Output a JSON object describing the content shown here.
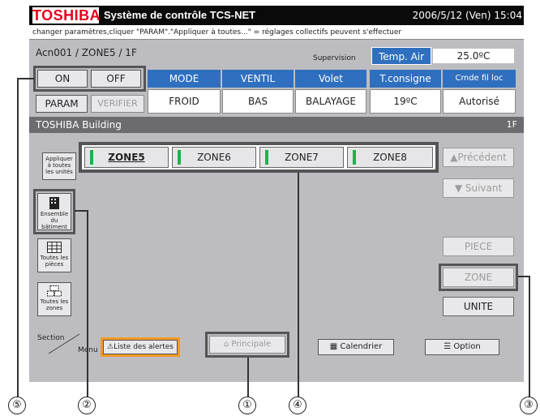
{
  "topbar": {
    "logo": "TOSHIBA",
    "title": "Système de contrôle TCS-NET",
    "datetime": "2006/5/12 (Ven)  15:04"
  },
  "hint": "changer paramètres,cliquer \"PARAM\".\"Appliquer à toutes...\" = réglages collectifs peuvent s'effectuer",
  "unit": {
    "id": "Acn001 / ZONE5 / 1F",
    "supervision": "Supervision"
  },
  "temp_air": {
    "label": "Temp. Air",
    "value": "25.0ºC"
  },
  "controls": {
    "on": "ON",
    "off": "OFF",
    "param": "PARAM",
    "verifier": "VERIFIER"
  },
  "status": [
    {
      "label": "MODE",
      "value": "FROID"
    },
    {
      "label": "VENTIL",
      "value": "BAS"
    },
    {
      "label": "Volet",
      "value": "BALAYAGE"
    },
    {
      "label": "T.consigne",
      "value": "19ºC"
    },
    {
      "label": "Cmde fil loc",
      "value": "Autorisé"
    }
  ],
  "building": {
    "name": "TOSHIBA Building",
    "floor": "1F"
  },
  "apply_all": {
    "line1": "Appliquer",
    "line2": "à toutes",
    "line3": "les unités"
  },
  "zones": [
    "ZONE5",
    "ZONE6",
    "ZONE7",
    "ZONE8"
  ],
  "nav": {
    "prev": "▲Précédent",
    "next": "▼ Suivant"
  },
  "side": [
    {
      "line1": "Ensemble",
      "line2": "du",
      "line3": "bâtiment",
      "icon": "building-icon"
    },
    {
      "line1": "Toutes les",
      "line2": "pièces",
      "line3": "",
      "icon": "rooms-grid-icon"
    },
    {
      "line1": "Toutes les",
      "line2": "zones",
      "line3": "",
      "icon": "zones-icon"
    }
  ],
  "right_buttons": {
    "piece": "PIECE",
    "zone": "ZONE",
    "unite": "UNITE"
  },
  "bottom": {
    "section": "Section",
    "menu": "Menu",
    "alerts": "Liste des alertes",
    "principale": "Principale",
    "calendrier": "Calendrier",
    "option": "Option"
  },
  "callouts": [
    "⑤",
    "②",
    "①",
    "④",
    "③"
  ],
  "colors": {
    "header_blue": "#2f6fbf",
    "zone_green": "#22b14c",
    "alert_orange": "#f39a26",
    "logo_red": "#e3001b"
  }
}
